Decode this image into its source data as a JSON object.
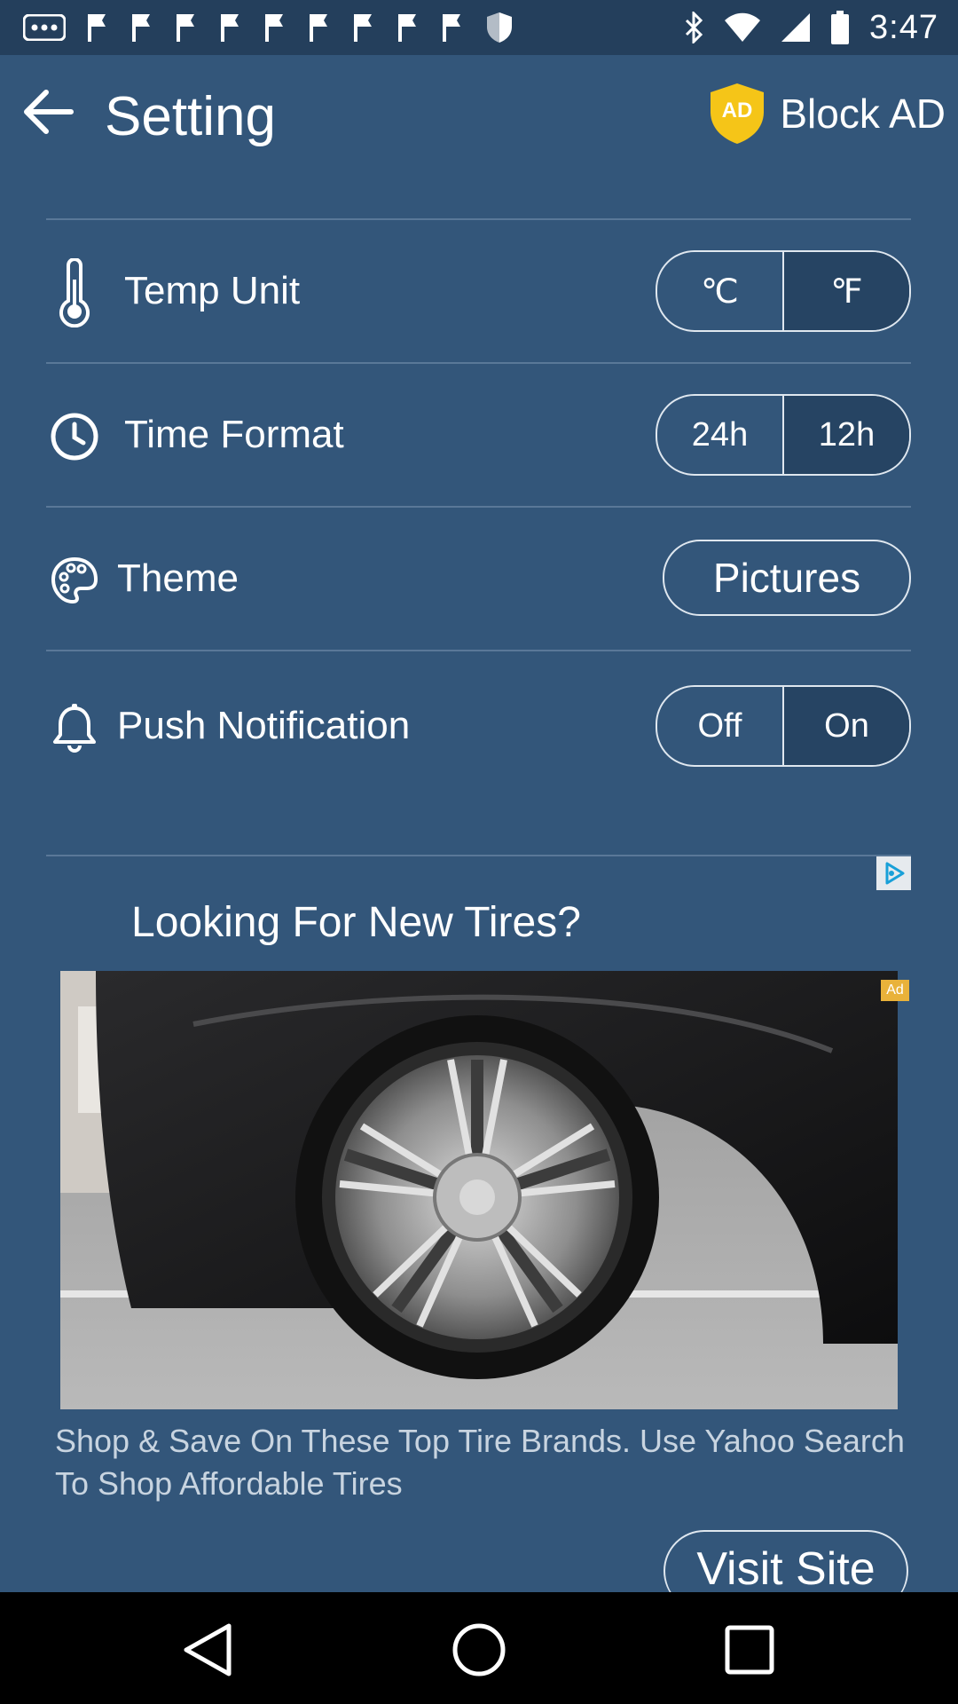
{
  "status_bar": {
    "time": "3:47",
    "icons": [
      "more-dots-icon",
      "flag-icon",
      "flag-icon",
      "flag-icon",
      "flag-icon",
      "flag-icon",
      "flag-icon",
      "flag-icon",
      "flag-icon",
      "flag-icon",
      "shield-icon",
      "bluetooth-icon",
      "wifi-icon",
      "signal-icon",
      "battery-icon"
    ]
  },
  "header": {
    "back_icon": "arrow-left-icon",
    "title": "Setting",
    "block_ad_badge": "AD",
    "block_ad_label": "Block AD"
  },
  "settings": {
    "temp_unit": {
      "label": "Temp Unit",
      "icon": "thermometer-icon",
      "options": [
        "℃",
        "℉"
      ],
      "selected": "℉"
    },
    "time_format": {
      "label": "Time Format",
      "icon": "clock-icon",
      "options": [
        "24h",
        "12h"
      ],
      "selected": "12h"
    },
    "theme": {
      "label": "Theme",
      "icon": "palette-icon",
      "value": "Pictures"
    },
    "push_notification": {
      "label": "Push Notification",
      "icon": "bell-icon",
      "options": [
        "Off",
        "On"
      ],
      "selected": "On"
    }
  },
  "ad": {
    "title": "Looking For New Tires?",
    "badge": "Ad",
    "description": "Shop & Save On These Top Tire Brands. Use Yahoo Search To Shop Affordable Tires",
    "cta": "Visit Site",
    "image_alt_icon": "car-wheel-photo"
  },
  "nav_bar": {
    "buttons": [
      "back-triangle-icon",
      "home-circle-icon",
      "recents-square-icon"
    ]
  },
  "colors": {
    "background": "#33567a",
    "status_bar": "#243f5c",
    "selected_segment": "#264463",
    "shield": "#f5c518"
  }
}
